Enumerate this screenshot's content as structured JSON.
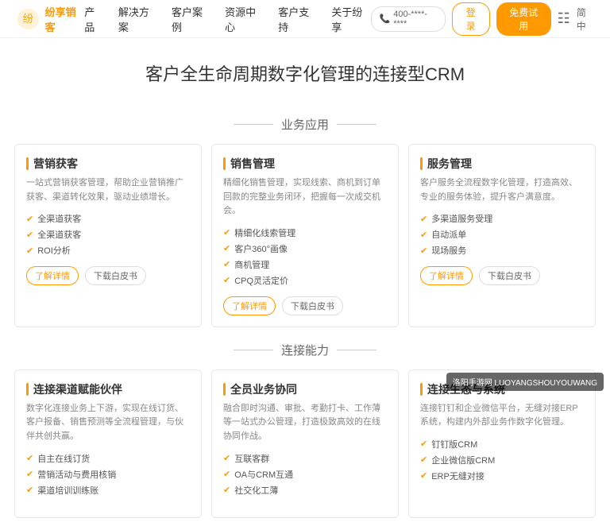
{
  "nav": {
    "logo_alt": "纷享销客",
    "links": [
      "产品",
      "解决方案",
      "客户案例",
      "资源中心",
      "客户支持",
      "关于纷享"
    ],
    "phone": "400-****-****",
    "btn_login": "登录",
    "btn_trial": "免费试用",
    "qr_icon": "二维码"
  },
  "hero": {
    "title": "客户全生命周期数字化管理的连接型CRM"
  },
  "section_business": {
    "label": "业务应用"
  },
  "section_connect": {
    "label": "连接能力"
  },
  "cards_business": [
    {
      "id": "marketing",
      "title": "营销获客",
      "desc": "一站式营销获客管理，帮助企业营销推广获客、渠道转化效果，驱动业绩增长。",
      "features": [
        "全渠道获客",
        "全渠道获客",
        "ROI分析"
      ],
      "btn_detail": "了解详情",
      "btn_whitepaper": "下载白皮书"
    },
    {
      "id": "sales",
      "title": "销售管理",
      "desc": "精细化销售管理，实现线索、商机到订单回款的完整业务闭环，把握每一次成交机会。",
      "features": [
        "精细化线索管理",
        "客户360°画像",
        "商机管理",
        "CPQ灵活定价"
      ],
      "btn_detail": "了解详情",
      "btn_whitepaper": "下载白皮书"
    },
    {
      "id": "service",
      "title": "服务管理",
      "desc": "客户服务全流程数字化管理，打造高效、专业的服务体验，提升客户满意度。",
      "features": [
        "多渠道服务受理",
        "自动派单",
        "现场服务"
      ],
      "btn_detail": "了解详情",
      "btn_whitepaper": "下载白皮书"
    }
  ],
  "cards_connect": [
    {
      "id": "channel",
      "title": "连接渠道赋能伙伴",
      "desc": "数字化连接业务上下游，实现在线订货、客户报备、销售预测等全流程管理，与伙伴共创共赢。",
      "features": [
        "自主在线订货",
        "营销活动与费用核销",
        "渠道培训训练账"
      ],
      "btn_detail": "",
      "btn_whitepaper": ""
    },
    {
      "id": "collaboration",
      "title": "全员业务协同",
      "desc": "融合即时沟通、审批、考勤打卡、工作薄等一站式办公管理，打造极致高效的在线协同作战。",
      "features": [
        "互联客群",
        "OA与CRM互通",
        "社交化工薄"
      ],
      "btn_detail": "",
      "btn_whitepaper": ""
    },
    {
      "id": "ecosystem",
      "title": "连接生态与系统",
      "desc": "连接钉钉和企业微信平台，无缝对接ERP系统，构建内外部业务作数字化管理。",
      "features": [
        "钉钉版CRM",
        "企业微信版CRM",
        "ERP无缝对接"
      ],
      "btn_detail": "",
      "btn_whitepaper": ""
    }
  ],
  "watermark": {
    "text": "洛阳手游网 LUOYANGSHOUYOUWANG"
  }
}
